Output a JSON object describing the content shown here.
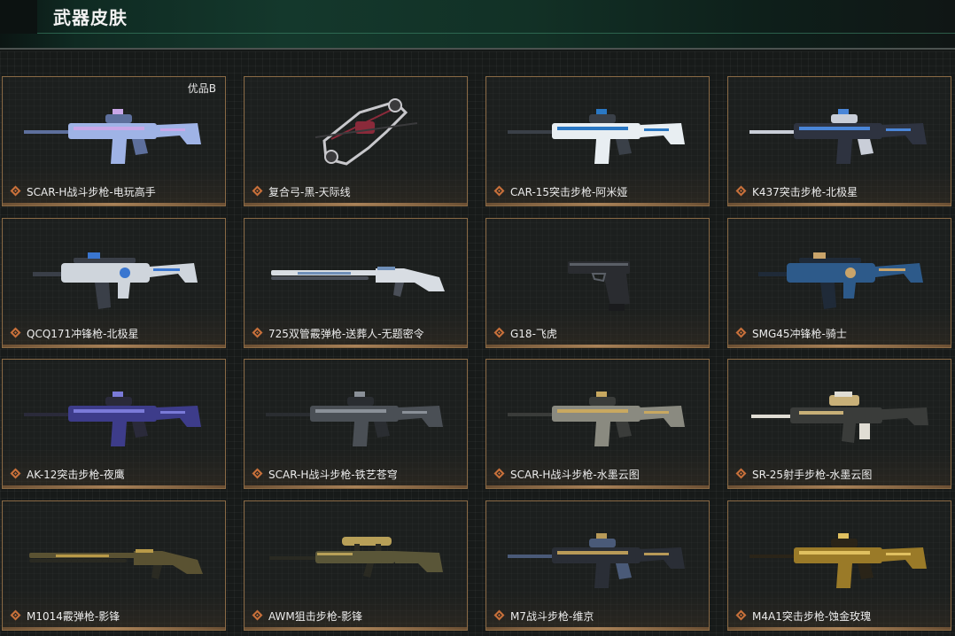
{
  "header": {
    "title": "武器皮肤"
  },
  "cards": [
    {
      "name": "SCAR-H战斗步枪-电玩高手",
      "badge": "优品B",
      "weapon_icon": "assault-rifle-icon",
      "colors": {
        "body": "#9fb3e6",
        "accent": "#c9a7e8",
        "trim": "#5d6f9c"
      }
    },
    {
      "name": "复合弓-黑-天际线",
      "badge": "",
      "weapon_icon": "compound-bow-icon",
      "colors": {
        "body": "#3a3a3c",
        "accent": "#c8c8cc",
        "trim": "#8a2a3a"
      }
    },
    {
      "name": "CAR-15突击步枪-阿米娅",
      "badge": "",
      "weapon_icon": "assault-rifle-icon",
      "colors": {
        "body": "#e8eef2",
        "accent": "#2a78c4",
        "trim": "#3a4048"
      }
    },
    {
      "name": "K437突击步枪-北极星",
      "badge": "",
      "weapon_icon": "assault-rifle-icon",
      "colors": {
        "body": "#2e3340",
        "accent": "#4a86d8",
        "trim": "#c9ced8"
      }
    },
    {
      "name": "QCQ171冲锋枪-北极星",
      "badge": "",
      "weapon_icon": "smg-icon",
      "colors": {
        "body": "#cfd5dc",
        "accent": "#3a76d0",
        "trim": "#3a3f48"
      }
    },
    {
      "name": "725双管霰弹枪-送葬人-无题密令",
      "badge": "",
      "weapon_icon": "shotgun-icon",
      "colors": {
        "body": "#d8dde3",
        "accent": "#6f8fb8",
        "trim": "#4a4f58"
      }
    },
    {
      "name": "G18-飞虎",
      "badge": "",
      "weapon_icon": "pistol-icon",
      "colors": {
        "body": "#2a2c30",
        "accent": "#5a5f66",
        "trim": "#1a1b1d"
      }
    },
    {
      "name": "SMG45冲锋枪-骑士",
      "badge": "",
      "weapon_icon": "smg-icon",
      "colors": {
        "body": "#2d5a8a",
        "accent": "#c9a46a",
        "trim": "#1f2a38"
      }
    },
    {
      "name": "AK-12突击步枪-夜鹰",
      "badge": "",
      "weapon_icon": "assault-rifle-icon",
      "colors": {
        "body": "#3d3c8a",
        "accent": "#7a7ad8",
        "trim": "#2a2a3a"
      }
    },
    {
      "name": "SCAR-H战斗步枪-铁艺苍穹",
      "badge": "",
      "weapon_icon": "assault-rifle-icon",
      "colors": {
        "body": "#4a4f55",
        "accent": "#8a9098",
        "trim": "#2a2d31"
      }
    },
    {
      "name": "SCAR-H战斗步枪-水墨云图",
      "badge": "",
      "weapon_icon": "assault-rifle-icon",
      "colors": {
        "body": "#8a8a80",
        "accent": "#c8a860",
        "trim": "#3a3c3a"
      }
    },
    {
      "name": "SR-25射手步枪-水墨云图",
      "badge": "",
      "weapon_icon": "marksman-rifle-icon",
      "colors": {
        "body": "#3a3c3a",
        "accent": "#c8b078",
        "trim": "#e0ddd4"
      }
    },
    {
      "name": "M1014霰弹枪-影锋",
      "badge": "",
      "weapon_icon": "shotgun-icon",
      "colors": {
        "body": "#5a5232",
        "accent": "#b89a48",
        "trim": "#2a2a22"
      }
    },
    {
      "name": "AWM狙击步枪-影锋",
      "badge": "",
      "weapon_icon": "sniper-rifle-icon",
      "colors": {
        "body": "#5a5638",
        "accent": "#b8a058",
        "trim": "#2a2a22"
      }
    },
    {
      "name": "M7战斗步枪-维京",
      "badge": "",
      "weapon_icon": "assault-rifle-icon",
      "colors": {
        "body": "#2a2e36",
        "accent": "#b89a58",
        "trim": "#4a5a78"
      }
    },
    {
      "name": "M4A1突击步枪-蚀金玫瑰",
      "badge": "",
      "weapon_icon": "assault-rifle-icon",
      "colors": {
        "body": "#9a7a28",
        "accent": "#e0c060",
        "trim": "#2a2418"
      }
    }
  ],
  "colors": {
    "card_border": "#8a6a45",
    "rarity_icon": "#c8703a",
    "header_accent": "#3f8a6c"
  }
}
